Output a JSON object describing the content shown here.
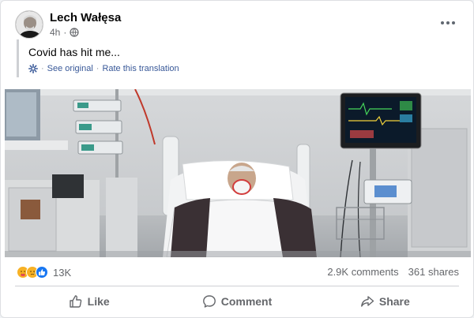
{
  "post": {
    "author": "Lech Wałęsa",
    "time": "4h",
    "visibility_icon": "globe-icon",
    "more_icon": "more-horizontal-icon",
    "text": "Covid has hit me...",
    "translation": {
      "icon": "gear-icon",
      "see_original": "See original",
      "separator": "·",
      "rate": "Rate this translation"
    }
  },
  "engagement": {
    "reaction_icons": [
      "care-reaction-icon",
      "sad-reaction-icon",
      "like-reaction-icon"
    ],
    "reaction_count": "13K",
    "comments": "2.9K comments",
    "shares": "361 shares"
  },
  "actions": {
    "like": "Like",
    "comment": "Comment",
    "share": "Share"
  },
  "colors": {
    "link": "#385898",
    "secondary_text": "#65676b",
    "like_blue": "#1877f2",
    "reaction_yellow": "#f7b125"
  }
}
